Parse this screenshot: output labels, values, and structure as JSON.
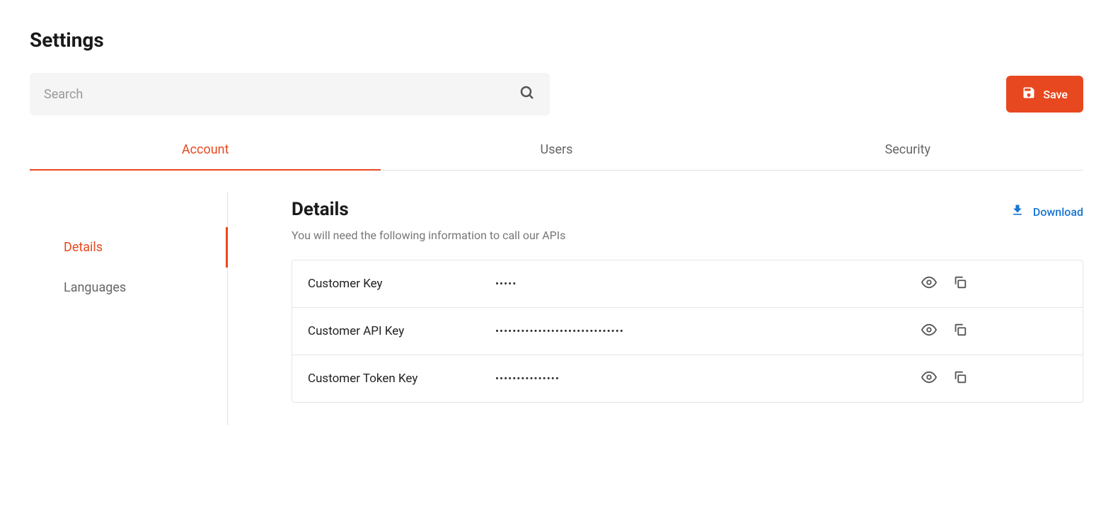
{
  "header": {
    "title": "Settings"
  },
  "search": {
    "placeholder": "Search",
    "value": ""
  },
  "toolbar": {
    "save_label": "Save"
  },
  "tabs": [
    {
      "label": "Account",
      "active": true
    },
    {
      "label": "Users",
      "active": false
    },
    {
      "label": "Security",
      "active": false
    }
  ],
  "sidebar": {
    "items": [
      {
        "label": "Details",
        "active": true
      },
      {
        "label": "Languages",
        "active": false
      }
    ]
  },
  "section": {
    "title": "Details",
    "description": "You will need the following information to call our APIs",
    "download_label": "Download"
  },
  "keys": [
    {
      "label": "Customer Key",
      "value": "•••••"
    },
    {
      "label": "Customer API Key",
      "value": "••••••••••••••••••••••••••••••"
    },
    {
      "label": "Customer Token Key",
      "value": "•••••••••••••••"
    }
  ],
  "colors": {
    "accent": "#e8481f",
    "link": "#1976d2"
  }
}
